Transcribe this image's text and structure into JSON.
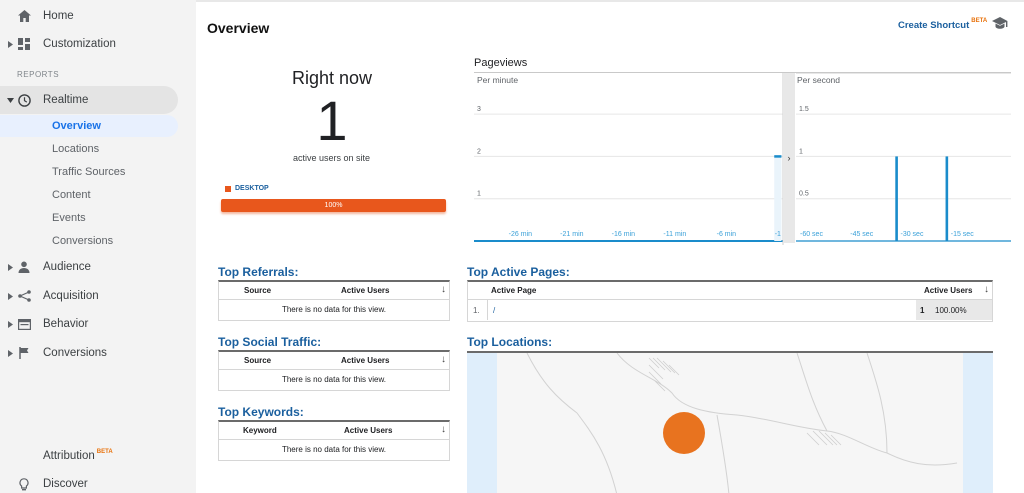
{
  "sidebar": {
    "home": "Home",
    "customization": "Customization",
    "reports_label": "REPORTS",
    "realtime": "Realtime",
    "realtime_items": [
      "Overview",
      "Locations",
      "Traffic Sources",
      "Content",
      "Events",
      "Conversions"
    ],
    "audience": "Audience",
    "acquisition": "Acquisition",
    "behavior": "Behavior",
    "conversions": "Conversions",
    "attribution": "Attribution",
    "attribution_badge": "BETA",
    "discover": "Discover"
  },
  "header": {
    "title": "Overview",
    "create_shortcut": "Create Shortcut",
    "create_shortcut_badge": "BETA"
  },
  "right_now": {
    "title": "Right now",
    "count": "1",
    "subtitle": "active users on site",
    "device_label": "DESKTOP",
    "device_share": 1.0,
    "device_share_label": "100%",
    "device_color": "#e8571c"
  },
  "pageviews": {
    "title": "Pageviews",
    "per_minute_label": "Per minute",
    "per_second_label": "Per second",
    "per_minute_y_ticks": [
      "3",
      "2",
      "1"
    ],
    "per_minute_x_ticks": [
      "-26 min",
      "-21 min",
      "-16 min",
      "-11 min",
      "-6 min",
      "-1"
    ],
    "per_second_y_ticks": [
      "1.5",
      "1",
      "0.5"
    ],
    "per_second_x_ticks": [
      "-60 sec",
      "-45 sec",
      "-30 sec",
      "-15 sec"
    ]
  },
  "chart_data": [
    {
      "type": "bar",
      "title": "Per minute",
      "x": [
        "-30 min",
        "-29 min",
        "-28 min",
        "-27 min",
        "-26 min",
        "-25 min",
        "-24 min",
        "-23 min",
        "-22 min",
        "-21 min",
        "-20 min",
        "-19 min",
        "-18 min",
        "-17 min",
        "-16 min",
        "-15 min",
        "-14 min",
        "-13 min",
        "-12 min",
        "-11 min",
        "-10 min",
        "-9 min",
        "-8 min",
        "-7 min",
        "-6 min",
        "-5 min",
        "-4 min",
        "-3 min",
        "-2 min",
        "-1 min"
      ],
      "values": [
        0,
        0,
        0,
        0,
        0,
        0,
        0,
        0,
        0,
        0,
        0,
        0,
        0,
        0,
        0,
        0,
        0,
        0,
        0,
        0,
        0,
        0,
        0,
        0,
        0,
        0,
        0,
        0,
        0,
        2
      ],
      "ylim": [
        0,
        3.5
      ],
      "grid": true,
      "color": "#1a8ccb"
    },
    {
      "type": "bar",
      "title": "Per second",
      "x": [
        -60,
        -30,
        -28,
        -15,
        -14
      ],
      "values": [
        0,
        1,
        0,
        1,
        0
      ],
      "ylim": [
        0,
        1.75
      ],
      "grid": true,
      "color": "#1a8ccb"
    }
  ],
  "top_referrals": {
    "title": "Top Referrals:",
    "col_source": "Source",
    "col_active": "Active Users",
    "empty": "There is no data for this view."
  },
  "top_social": {
    "title": "Top Social Traffic:",
    "col_source": "Source",
    "col_active": "Active Users",
    "empty": "There is no data for this view."
  },
  "top_keywords": {
    "title": "Top Keywords:",
    "col_keyword": "Keyword",
    "col_active": "Active Users",
    "empty": "There is no data for this view."
  },
  "top_active_pages": {
    "title": "Top Active Pages:",
    "col_page": "Active Page",
    "col_active": "Active Users",
    "rows": [
      {
        "index": "1.",
        "page": "/",
        "users": "1",
        "percent": "100.00%"
      }
    ]
  },
  "top_locations": {
    "title": "Top Locations:",
    "marker_color": "#e8731f"
  },
  "colors": {
    "link_blue": "#1a5f9e",
    "accent_orange": "#e8571c",
    "chart_blue": "#1a8ccb"
  }
}
